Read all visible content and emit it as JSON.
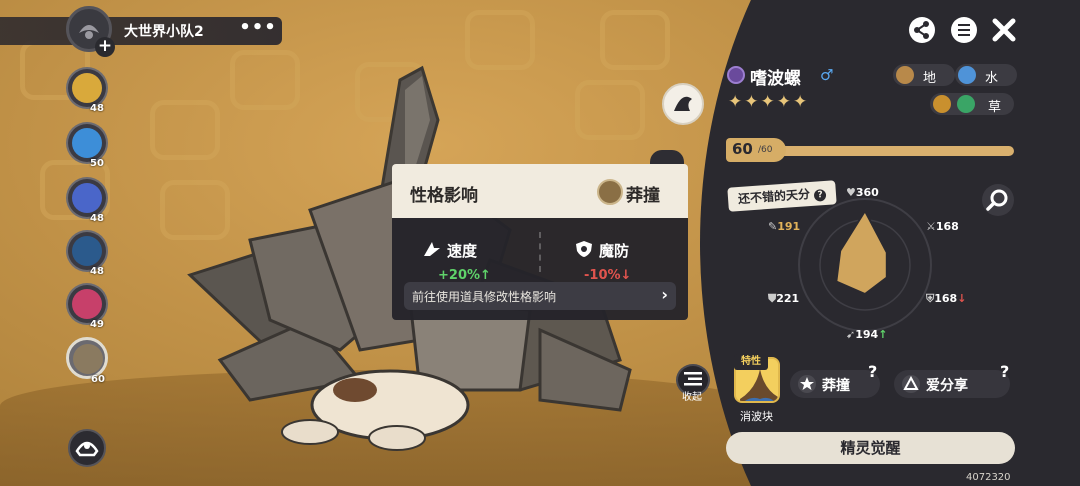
{
  "squad": {
    "name": "大世界小队2",
    "more_label": "•••",
    "add_label": "+"
  },
  "pets": [
    {
      "level": "48",
      "color": "#d9a93b"
    },
    {
      "level": "50",
      "color": "#3d8ed8"
    },
    {
      "level": "48",
      "color": "#4a66c9"
    },
    {
      "level": "48",
      "color": "#2b5a8c"
    },
    {
      "level": "49",
      "color": "#c7406a"
    },
    {
      "level": "60",
      "color": "#8a7a60",
      "selected": true
    }
  ],
  "nature_popup": {
    "title": "性格影响",
    "move_name": "莽撞",
    "up_stat": {
      "name": "速度",
      "value": "+20%",
      "arrow": "↑",
      "color": "#5fd36a"
    },
    "down_stat": {
      "name": "魔防",
      "value": "-10%",
      "arrow": "↓",
      "color": "#e0544e"
    },
    "link_text": "前往使用道具修改性格影响",
    "link_arrow": "›"
  },
  "collapse_label": "收起",
  "pet_detail": {
    "name": "嗜波螺",
    "gender_symbol": "♂",
    "stars": "✦✦✦✦✦",
    "types": [
      {
        "label": "地",
        "color": "#b8894a"
      },
      {
        "label": "水",
        "color": "#4f93d8"
      },
      {
        "label": "草",
        "color": "#3aa566"
      }
    ],
    "level_current": "60",
    "level_max": "/60",
    "level_progress": 1.0,
    "talent_label": "还不错的天分",
    "talent_help": "?",
    "stats": {
      "hp": "360",
      "atk": "168",
      "mdef": "168",
      "spd": "194",
      "def": "221",
      "matk": "191"
    },
    "trait_tag": "特性",
    "trait_name": "消波块",
    "skills": [
      {
        "label": "莽撞",
        "help": "?"
      },
      {
        "label": "爱分享",
        "help": "?"
      }
    ],
    "awaken_label": "精灵觉醒",
    "uid": "4072320"
  },
  "colors": {
    "panel_bg": "#2a292f",
    "accent_gold": "#d9b06e",
    "hex_fill": "#d0a55d"
  },
  "icons": [
    "share-icon",
    "list-icon",
    "close-icon",
    "search-icon"
  ]
}
